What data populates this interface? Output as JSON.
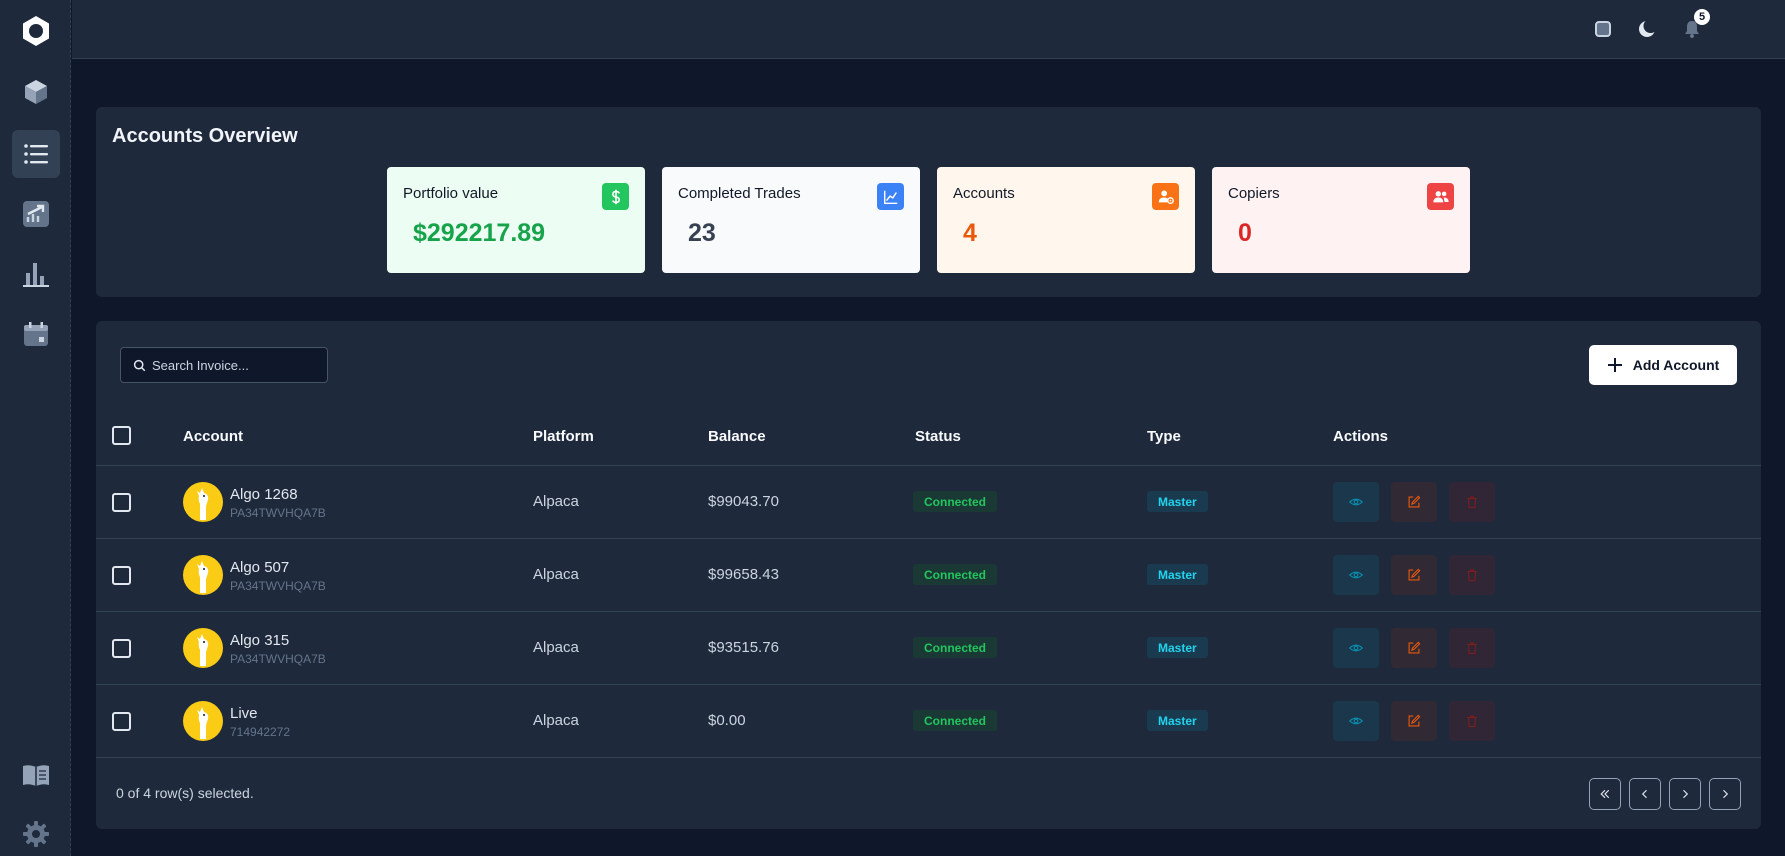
{
  "topbar": {
    "notification_count": "5"
  },
  "overview": {
    "title": "Accounts Overview",
    "cards": [
      {
        "label": "Portfolio value",
        "value": "$292217.89",
        "value_color": "#16a34a",
        "bg": "#ecfdf3",
        "icon": "dollar-icon",
        "icon_bg": "#22c55e"
      },
      {
        "label": "Completed Trades",
        "value": "23",
        "value_color": "#374151",
        "bg": "#f8fafc",
        "icon": "line-chart-icon",
        "icon_bg": "#3b82f6"
      },
      {
        "label": "Accounts",
        "value": "4",
        "value_color": "#ea580c",
        "bg": "#fff7ed",
        "icon": "user-gear-icon",
        "icon_bg": "#f97316"
      },
      {
        "label": "Copiers",
        "value": "0",
        "value_color": "#dc2626",
        "bg": "#fef2f2",
        "icon": "users-icon",
        "icon_bg": "#ef4444"
      }
    ]
  },
  "search": {
    "placeholder": "Search Invoice..."
  },
  "add_button": {
    "label": "Add Account"
  },
  "table": {
    "columns": [
      "Account",
      "Platform",
      "Balance",
      "Status",
      "Type",
      "Actions"
    ],
    "rows": [
      {
        "name": "Algo 1268",
        "id": "PA34TWVHQA7B",
        "platform": "Alpaca",
        "balance": "$99043.70",
        "status": "Connected",
        "type": "Master"
      },
      {
        "name": "Algo 507",
        "id": "PA34TWVHQA7B",
        "platform": "Alpaca",
        "balance": "$99658.43",
        "status": "Connected",
        "type": "Master"
      },
      {
        "name": "Algo 315",
        "id": "PA34TWVHQA7B",
        "platform": "Alpaca",
        "balance": "$93515.76",
        "status": "Connected",
        "type": "Master"
      },
      {
        "name": "Live",
        "id": "714942272",
        "platform": "Alpaca",
        "balance": "$0.00",
        "status": "Connected",
        "type": "Master"
      }
    ]
  },
  "footer": {
    "selection_text": "0 of 4 row(s) selected."
  },
  "colors": {
    "bg": "#0f172a",
    "panel": "#1e293b",
    "border": "#334155",
    "accent_green": "#22c55e",
    "accent_cyan": "#22d3ee",
    "accent_orange": "#f97316",
    "accent_red": "#ef4444",
    "avatar_yellow": "#facc15"
  }
}
